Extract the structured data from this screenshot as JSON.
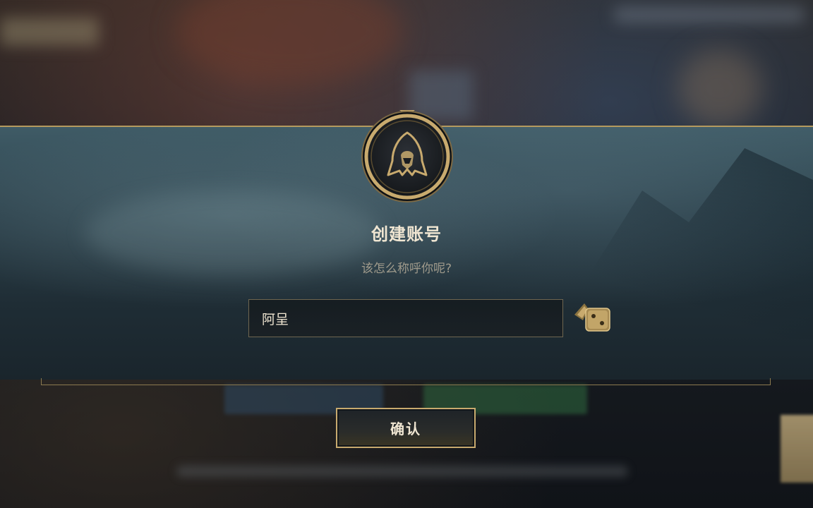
{
  "dialog": {
    "title": "创建账号",
    "subtitle": "该怎么称呼你呢?",
    "name_value": "阿呈",
    "confirm_label": "确认"
  },
  "icons": {
    "emblem": "hooded-figure-icon",
    "random": "dice-icon"
  },
  "colors": {
    "gold": "#c8aa6e",
    "text_light": "#f0e6d2",
    "text_muted": "#a09b8c",
    "panel": "#2c414b"
  }
}
